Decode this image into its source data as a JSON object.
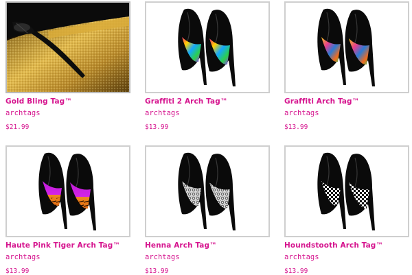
{
  "products": [
    {
      "title": "Gold Bling Tag™",
      "vendor": "archtags",
      "price": "$21.99",
      "image": "gold-bling-photo"
    },
    {
      "title": "Graffiti 2 Arch Tag™",
      "vendor": "archtags",
      "price": "$13.99",
      "image": "graffiti-2-heels"
    },
    {
      "title": "Graffiti Arch Tag™",
      "vendor": "archtags",
      "price": "$13.99",
      "image": "graffiti-heels"
    },
    {
      "title": "Haute Pink Tiger Arch Tag™",
      "vendor": "archtags",
      "price": "$13.99",
      "image": "pink-tiger-heels"
    },
    {
      "title": "Henna Arch Tag™",
      "vendor": "archtags",
      "price": "$13.99",
      "image": "henna-heels"
    },
    {
      "title": "Houndstooth Arch Tag™",
      "vendor": "archtags",
      "price": "$13.99",
      "image": "houndstooth-heels"
    }
  ],
  "colors": {
    "accent": "#d6168f",
    "border": "#cfcfcf",
    "shoe": "#0a0a0a",
    "gold": "#c89a2a"
  }
}
